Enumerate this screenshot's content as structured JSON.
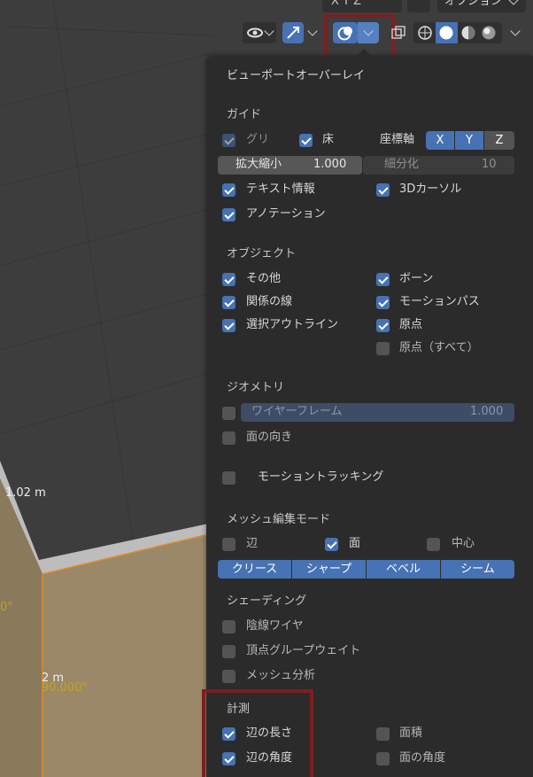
{
  "header": {
    "axes_partial": "X Y Z",
    "options_label": "オプション"
  },
  "viewport": {
    "measure_edge": "1.02 m",
    "measure_edge2": "2 m",
    "measure_angle": "90.000°",
    "measure_angle_left": "0°"
  },
  "popover": {
    "title": "ビューポートオーバーレイ",
    "guides": {
      "heading": "ガイド",
      "grid": {
        "label": "グリ",
        "checked": true
      },
      "floor": {
        "label": "床",
        "checked": true
      },
      "axes_label": "座標軸",
      "axes": [
        {
          "label": "X",
          "on": true
        },
        {
          "label": "Y",
          "on": true
        },
        {
          "label": "Z",
          "on": false
        }
      ],
      "scale": {
        "label": "拡大縮小",
        "value": "1.000"
      },
      "subdiv": {
        "label": "細分化",
        "value": "10"
      },
      "text_info": {
        "label": "テキスト情報",
        "checked": true
      },
      "cursor_3d": {
        "label": "3Dカーソル",
        "checked": true
      },
      "annotations": {
        "label": "アノテーション",
        "checked": true
      }
    },
    "objects": {
      "heading": "オブジェクト",
      "extras": {
        "label": "その他",
        "checked": true
      },
      "bones": {
        "label": "ボーン",
        "checked": true
      },
      "relationship_lines": {
        "label": "関係の線",
        "checked": true
      },
      "motion_paths": {
        "label": "モーションパス",
        "checked": true
      },
      "outline_selected": {
        "label": "選択アウトライン",
        "checked": true
      },
      "origins": {
        "label": "原点",
        "checked": true
      },
      "origins_all": {
        "label": "原点（すべて）",
        "checked": false
      }
    },
    "geometry": {
      "heading": "ジオメトリ",
      "wireframe": {
        "label": "ワイヤーフレーム",
        "value": "1.000",
        "checked": false
      },
      "face_orientation": {
        "label": "面の向き",
        "checked": false
      }
    },
    "motion_tracking": {
      "label": "モーショントラッキング",
      "checked": false
    },
    "mesh_edit": {
      "heading": "メッシュ編集モード",
      "edges": {
        "label": "辺",
        "checked": false
      },
      "faces": {
        "label": "面",
        "checked": true
      },
      "center": {
        "label": "中心",
        "checked": false
      },
      "buttons": [
        "クリース",
        "シャープ",
        "ベベル",
        "シーム"
      ]
    },
    "shading": {
      "heading": "シェーディング",
      "hidden_wire": {
        "label": "陰線ワイヤ",
        "checked": false
      },
      "vertex_group_weights": {
        "label": "頂点グループウェイト",
        "checked": false
      },
      "mesh_analysis": {
        "label": "メッシュ分析",
        "checked": false
      }
    },
    "measurement": {
      "heading": "計測",
      "edge_length": {
        "label": "辺の長さ",
        "checked": true
      },
      "face_area": {
        "label": "面積",
        "checked": false
      },
      "edge_angle": {
        "label": "辺の角度",
        "checked": true
      },
      "face_angle": {
        "label": "面の角度",
        "checked": false
      }
    }
  },
  "colors": {
    "accent": "#4772b3",
    "highlight_frame": "#7d1f22",
    "panel_bg": "#2b2b2b",
    "viewport_bg": "#3d3d3d"
  }
}
